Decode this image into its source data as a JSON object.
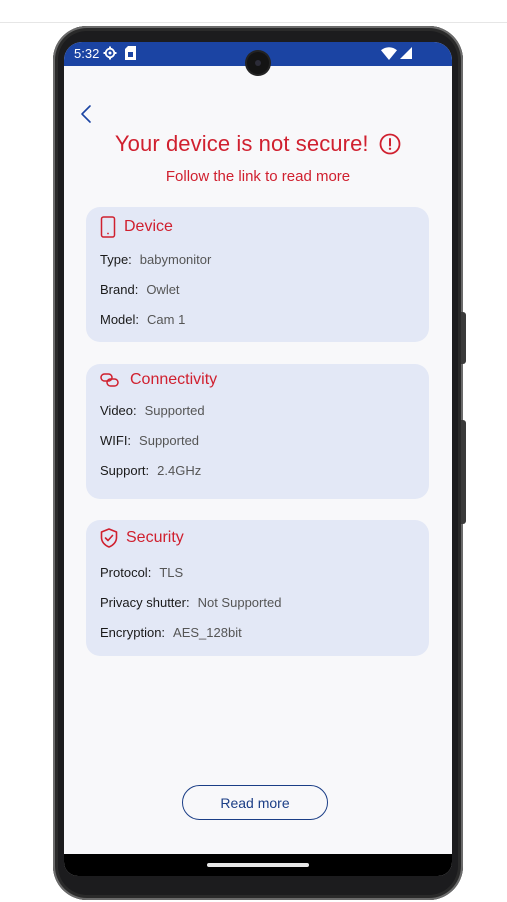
{
  "status_bar": {
    "time": "5:32",
    "icons": [
      "gear-icon",
      "sim-card-icon",
      "wifi-icon",
      "signal-icon"
    ],
    "background": "#1b44a3"
  },
  "header": {
    "back_icon": "chevron-left-icon",
    "title": "Your device is not secure!",
    "title_icon": "alert-circle-icon",
    "subtitle": "Follow the link to read more"
  },
  "cards": {
    "device": {
      "title": "Device",
      "icon": "phone-icon",
      "rows": [
        {
          "label": "Type:",
          "value": "babymonitor"
        },
        {
          "label": "Brand:",
          "value": "Owlet"
        },
        {
          "label": "Model:",
          "value": "Cam 1"
        }
      ]
    },
    "connectivity": {
      "title": "Connectivity",
      "icon": "link-icon",
      "rows": [
        {
          "label": "Video:",
          "value": "Supported"
        },
        {
          "label": "WIFI:",
          "value": "Supported"
        },
        {
          "label": "Support:",
          "value": "2.4GHz"
        }
      ]
    },
    "security": {
      "title": "Security",
      "icon": "shield-check-icon",
      "rows": [
        {
          "label": "Protocol:",
          "value": "TLS"
        },
        {
          "label": "Privacy shutter:",
          "value": "Not Supported"
        },
        {
          "label": "Encryption:",
          "value": "AES_128bit"
        }
      ]
    }
  },
  "actions": {
    "read_more_label": "Read more"
  },
  "colors": {
    "accent_red": "#d0202f",
    "card_bg": "#e3e8f6",
    "button_blue": "#1b3e86"
  }
}
